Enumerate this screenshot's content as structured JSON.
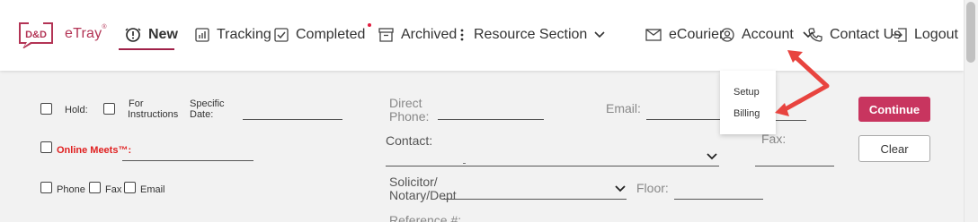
{
  "brand": {
    "logo_mark": "D&D",
    "name": "eTray",
    "reg": "®",
    "color": "#b33455"
  },
  "nav": {
    "new": "New",
    "tracking": "Tracking",
    "completed": "Completed",
    "archived": "Archived",
    "resource": "Resource Section",
    "ecourier": "eCourier",
    "account": "Account",
    "contact": "Contact Us",
    "logout": "Logout"
  },
  "account_menu": {
    "setup": "Setup",
    "billing": "Billing"
  },
  "form": {
    "hold": "Hold:",
    "for_instructions_1": "For",
    "for_instructions_2": "Instructions",
    "specific_date_1": "Specific",
    "specific_date_2": "Date:",
    "online_meets": "Online Meets™:",
    "phone": "Phone",
    "fax_opt": "Fax",
    "email_opt": "Email",
    "direct_phone_1": "Direct",
    "direct_phone_2": "Phone:",
    "email": "Email:",
    "contact": "Contact:",
    "fax": "Fax:",
    "solicitor_1": "Solicitor/",
    "solicitor_2": "Notary/Dept",
    "floor": "Floor:",
    "reference": "Reference #:"
  },
  "buttons": {
    "continue": "Continue",
    "clear": "Clear"
  },
  "colors": {
    "accent": "#c8355f",
    "annotation": "#e8443f",
    "online_meets": "#e02020"
  }
}
